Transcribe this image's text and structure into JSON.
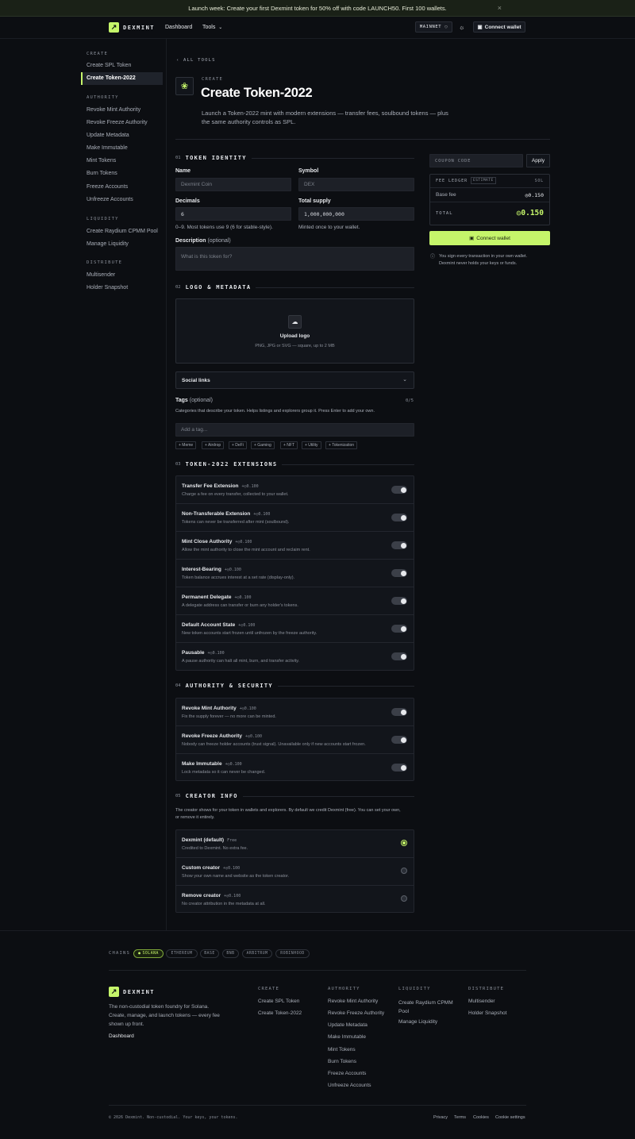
{
  "banner": {
    "text": "Launch week: Create your first Dexmint token for 50% off with code LAUNCH50. First 100 wallets.",
    "close": "×"
  },
  "header": {
    "brand": "DEXMINT",
    "nav": {
      "dashboard": "Dashboard",
      "tools": "Tools"
    },
    "network": "MAINNET",
    "connect": "Connect wallet"
  },
  "sidebar": {
    "groups": [
      {
        "title": "CREATE",
        "items": [
          "Create SPL Token",
          "Create Token-2022"
        ]
      },
      {
        "title": "AUTHORITY",
        "items": [
          "Revoke Mint Authority",
          "Revoke Freeze Authority",
          "Update Metadata",
          "Make Immutable",
          "Mint Tokens",
          "Burn Tokens",
          "Freeze Accounts",
          "Unfreeze Accounts"
        ]
      },
      {
        "title": "LIQUIDITY",
        "items": [
          "Create Raydium CPMM Pool",
          "Manage Liquidity"
        ]
      },
      {
        "title": "DISTRIBUTE",
        "items": [
          "Multisender",
          "Holder Snapshot"
        ]
      }
    ]
  },
  "page": {
    "back": "ALL TOOLS",
    "eyebrow": "CREATE",
    "title": "Create Token-2022",
    "desc_line1": "Launch a Token-2022 mint with modern extensions — transfer fees, soulbound tokens — plus",
    "desc_line2": "the same authority controls as SPL."
  },
  "identity": {
    "num": "01",
    "title": "TOKEN IDENTITY",
    "name_label": "Name",
    "name_placeholder": "Dexmint Coin",
    "symbol_label": "Symbol",
    "symbol_placeholder": "DEX",
    "decimals_label": "Decimals",
    "decimals_value": "6",
    "decimals_hint": "0–9. Most tokens use 9 (6 for stable-style).",
    "supply_label": "Total supply",
    "supply_value": "1,000,000,000",
    "supply_hint": "Minted once to your wallet.",
    "desc_label": "Description",
    "desc_optional": "(optional)",
    "desc_placeholder": "What is this token for?"
  },
  "logo": {
    "num": "02",
    "title": "LOGO & METADATA",
    "upload_title": "Upload logo",
    "upload_hint": "PNG, JPG or SVG — square, up to 2 MB",
    "social": "Social links",
    "tags_label": "Tags",
    "tags_optional": "(optional)",
    "tags_count": "0/5",
    "tags_hint": "Categories that describe your token. Helps listings and explorers group it. Press Enter to add your own.",
    "tags_placeholder": "Add a tag...",
    "chips": [
      "+ Meme",
      "+ Airdrop",
      "+ DeFi",
      "+ Gaming",
      "+ NFT",
      "+ Utility",
      "+ Tokenization"
    ]
  },
  "extensions": {
    "num": "03",
    "title": "TOKEN-2022 EXTENSIONS",
    "items": [
      {
        "title": "Transfer Fee Extension",
        "price": "+◎0.100",
        "desc": "Charge a fee on every transfer, collected to your wallet."
      },
      {
        "title": "Non-Transferable Extension",
        "price": "+◎0.100",
        "desc": "Tokens can never be transferred after mint (soulbound)."
      },
      {
        "title": "Mint Close Authority",
        "price": "+◎0.100",
        "desc": "Allow the mint authority to close the mint account and reclaim rent."
      },
      {
        "title": "Interest-Bearing",
        "price": "+◎0.100",
        "desc": "Token balance accrues interest at a set rate (display-only)."
      },
      {
        "title": "Permanent Delegate",
        "price": "+◎0.100",
        "desc": "A delegate address can transfer or burn any holder's tokens."
      },
      {
        "title": "Default Account State",
        "price": "+◎0.100",
        "desc": "New token accounts start frozen until unfrozen by the freeze authority."
      },
      {
        "title": "Pausable",
        "price": "+◎0.100",
        "desc": "A pause authority can halt all mint, burn, and transfer activity."
      }
    ]
  },
  "authority": {
    "num": "04",
    "title": "AUTHORITY & SECURITY",
    "items": [
      {
        "title": "Revoke Mint Authority",
        "price": "+◎0.100",
        "desc": "Fix the supply forever — no more can be minted."
      },
      {
        "title": "Revoke Freeze Authority",
        "price": "+◎0.100",
        "desc": "Nobody can freeze holder accounts (trust signal). Unavailable only if new accounts start frozen."
      },
      {
        "title": "Make Immutable",
        "price": "+◎0.100",
        "desc": "Lock metadata so it can never be changed."
      }
    ]
  },
  "creator": {
    "num": "05",
    "title": "CREATOR INFO",
    "intro_line1": "The creator shows for your token in wallets and explorers. By default we credit Dexmint (free). You can set your own,",
    "intro_line2": "or remove it entirely.",
    "items": [
      {
        "title": "Dexmint (default)",
        "price": "Free",
        "desc": "Credited to Dexmint. No extra fee."
      },
      {
        "title": "Custom creator",
        "price": "+◎0.100",
        "desc": "Show your own name and website as the token creator."
      },
      {
        "title": "Remove creator",
        "price": "+◎0.100",
        "desc": "No creator attribution in the metadata at all."
      }
    ]
  },
  "right": {
    "coupon_placeholder": "COUPON CODE",
    "apply": "Apply",
    "ledger": "FEE LEDGER",
    "estimate": "ESTIMATE",
    "currency": "SOL",
    "base_fee_label": "Base fee",
    "base_fee_value": "◎0.150",
    "total_label": "TOTAL",
    "total_value": "◎0.150",
    "connect": "Connect wallet",
    "note_line1": "You sign every transaction in your own wallet.",
    "note_line2": "Dexmint never holds your keys or funds."
  },
  "footer": {
    "chains_label": "CHAINS",
    "chains": [
      "SOLANA",
      "ETHEREUM",
      "BASE",
      "BNB",
      "ARBITRUM",
      "ROBINHOOD"
    ],
    "brand": "DEXMINT",
    "tagline_line1": "The non-custodial token foundry for Solana.",
    "tagline_line2": "Create, manage, and launch tokens — every fee",
    "tagline_line3": "shown up front.",
    "dashboard": "Dashboard",
    "columns": [
      {
        "title": "CREATE",
        "links": [
          "Create SPL Token",
          "Create Token-2022"
        ]
      },
      {
        "title": "AUTHORITY",
        "links": [
          "Revoke Mint Authority",
          "Revoke Freeze Authority",
          "Update Metadata",
          "Make Immutable",
          "Mint Tokens",
          "Burn Tokens",
          "Freeze Accounts",
          "Unfreeze Accounts"
        ]
      },
      {
        "title": "LIQUIDITY",
        "links": [
          "Create Raydium CPMM Pool",
          "Manage Liquidity"
        ]
      },
      {
        "title": "DISTRIBUTE",
        "links": [
          "Multisender",
          "Holder Snapshot"
        ]
      }
    ],
    "copyright": "© 2026 Dexmint. Non-custodial. Your keys, your tokens.",
    "legal": [
      "Privacy",
      "Terms",
      "Cookies",
      "Cookie settings"
    ]
  },
  "colors": {
    "accent": "#c5f56a",
    "bg": "#0c0e12",
    "panel": "#12151b",
    "border": "#23262e"
  }
}
